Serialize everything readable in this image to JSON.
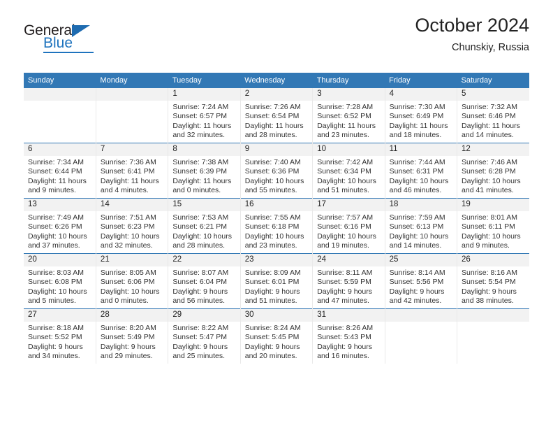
{
  "brand": {
    "name_part1": "General",
    "name_part2": "Blue"
  },
  "header": {
    "title": "October 2024",
    "location": "Chunskiy, Russia"
  },
  "weekday_headers": [
    "Sunday",
    "Monday",
    "Tuesday",
    "Wednesday",
    "Thursday",
    "Friday",
    "Saturday"
  ],
  "colors": {
    "header_blue": "#3278b5",
    "brand_blue": "#1e73be",
    "daynum_band": "#f2f2f2",
    "text": "#333333"
  },
  "weeks": [
    [
      {
        "day": "",
        "sunrise": "",
        "sunset": "",
        "daylight": "",
        "empty": true
      },
      {
        "day": "",
        "sunrise": "",
        "sunset": "",
        "daylight": "",
        "empty": true
      },
      {
        "day": "1",
        "sunrise": "Sunrise: 7:24 AM",
        "sunset": "Sunset: 6:57 PM",
        "daylight": "Daylight: 11 hours and 32 minutes."
      },
      {
        "day": "2",
        "sunrise": "Sunrise: 7:26 AM",
        "sunset": "Sunset: 6:54 PM",
        "daylight": "Daylight: 11 hours and 28 minutes."
      },
      {
        "day": "3",
        "sunrise": "Sunrise: 7:28 AM",
        "sunset": "Sunset: 6:52 PM",
        "daylight": "Daylight: 11 hours and 23 minutes."
      },
      {
        "day": "4",
        "sunrise": "Sunrise: 7:30 AM",
        "sunset": "Sunset: 6:49 PM",
        "daylight": "Daylight: 11 hours and 18 minutes."
      },
      {
        "day": "5",
        "sunrise": "Sunrise: 7:32 AM",
        "sunset": "Sunset: 6:46 PM",
        "daylight": "Daylight: 11 hours and 14 minutes."
      }
    ],
    [
      {
        "day": "6",
        "sunrise": "Sunrise: 7:34 AM",
        "sunset": "Sunset: 6:44 PM",
        "daylight": "Daylight: 11 hours and 9 minutes."
      },
      {
        "day": "7",
        "sunrise": "Sunrise: 7:36 AM",
        "sunset": "Sunset: 6:41 PM",
        "daylight": "Daylight: 11 hours and 4 minutes."
      },
      {
        "day": "8",
        "sunrise": "Sunrise: 7:38 AM",
        "sunset": "Sunset: 6:39 PM",
        "daylight": "Daylight: 11 hours and 0 minutes."
      },
      {
        "day": "9",
        "sunrise": "Sunrise: 7:40 AM",
        "sunset": "Sunset: 6:36 PM",
        "daylight": "Daylight: 10 hours and 55 minutes."
      },
      {
        "day": "10",
        "sunrise": "Sunrise: 7:42 AM",
        "sunset": "Sunset: 6:34 PM",
        "daylight": "Daylight: 10 hours and 51 minutes."
      },
      {
        "day": "11",
        "sunrise": "Sunrise: 7:44 AM",
        "sunset": "Sunset: 6:31 PM",
        "daylight": "Daylight: 10 hours and 46 minutes."
      },
      {
        "day": "12",
        "sunrise": "Sunrise: 7:46 AM",
        "sunset": "Sunset: 6:28 PM",
        "daylight": "Daylight: 10 hours and 41 minutes."
      }
    ],
    [
      {
        "day": "13",
        "sunrise": "Sunrise: 7:49 AM",
        "sunset": "Sunset: 6:26 PM",
        "daylight": "Daylight: 10 hours and 37 minutes."
      },
      {
        "day": "14",
        "sunrise": "Sunrise: 7:51 AM",
        "sunset": "Sunset: 6:23 PM",
        "daylight": "Daylight: 10 hours and 32 minutes."
      },
      {
        "day": "15",
        "sunrise": "Sunrise: 7:53 AM",
        "sunset": "Sunset: 6:21 PM",
        "daylight": "Daylight: 10 hours and 28 minutes."
      },
      {
        "day": "16",
        "sunrise": "Sunrise: 7:55 AM",
        "sunset": "Sunset: 6:18 PM",
        "daylight": "Daylight: 10 hours and 23 minutes."
      },
      {
        "day": "17",
        "sunrise": "Sunrise: 7:57 AM",
        "sunset": "Sunset: 6:16 PM",
        "daylight": "Daylight: 10 hours and 19 minutes."
      },
      {
        "day": "18",
        "sunrise": "Sunrise: 7:59 AM",
        "sunset": "Sunset: 6:13 PM",
        "daylight": "Daylight: 10 hours and 14 minutes."
      },
      {
        "day": "19",
        "sunrise": "Sunrise: 8:01 AM",
        "sunset": "Sunset: 6:11 PM",
        "daylight": "Daylight: 10 hours and 9 minutes."
      }
    ],
    [
      {
        "day": "20",
        "sunrise": "Sunrise: 8:03 AM",
        "sunset": "Sunset: 6:08 PM",
        "daylight": "Daylight: 10 hours and 5 minutes."
      },
      {
        "day": "21",
        "sunrise": "Sunrise: 8:05 AM",
        "sunset": "Sunset: 6:06 PM",
        "daylight": "Daylight: 10 hours and 0 minutes."
      },
      {
        "day": "22",
        "sunrise": "Sunrise: 8:07 AM",
        "sunset": "Sunset: 6:04 PM",
        "daylight": "Daylight: 9 hours and 56 minutes."
      },
      {
        "day": "23",
        "sunrise": "Sunrise: 8:09 AM",
        "sunset": "Sunset: 6:01 PM",
        "daylight": "Daylight: 9 hours and 51 minutes."
      },
      {
        "day": "24",
        "sunrise": "Sunrise: 8:11 AM",
        "sunset": "Sunset: 5:59 PM",
        "daylight": "Daylight: 9 hours and 47 minutes."
      },
      {
        "day": "25",
        "sunrise": "Sunrise: 8:14 AM",
        "sunset": "Sunset: 5:56 PM",
        "daylight": "Daylight: 9 hours and 42 minutes."
      },
      {
        "day": "26",
        "sunrise": "Sunrise: 8:16 AM",
        "sunset": "Sunset: 5:54 PM",
        "daylight": "Daylight: 9 hours and 38 minutes."
      }
    ],
    [
      {
        "day": "27",
        "sunrise": "Sunrise: 8:18 AM",
        "sunset": "Sunset: 5:52 PM",
        "daylight": "Daylight: 9 hours and 34 minutes."
      },
      {
        "day": "28",
        "sunrise": "Sunrise: 8:20 AM",
        "sunset": "Sunset: 5:49 PM",
        "daylight": "Daylight: 9 hours and 29 minutes."
      },
      {
        "day": "29",
        "sunrise": "Sunrise: 8:22 AM",
        "sunset": "Sunset: 5:47 PM",
        "daylight": "Daylight: 9 hours and 25 minutes."
      },
      {
        "day": "30",
        "sunrise": "Sunrise: 8:24 AM",
        "sunset": "Sunset: 5:45 PM",
        "daylight": "Daylight: 9 hours and 20 minutes."
      },
      {
        "day": "31",
        "sunrise": "Sunrise: 8:26 AM",
        "sunset": "Sunset: 5:43 PM",
        "daylight": "Daylight: 9 hours and 16 minutes."
      },
      {
        "day": "",
        "sunrise": "",
        "sunset": "",
        "daylight": "",
        "empty": true
      },
      {
        "day": "",
        "sunrise": "",
        "sunset": "",
        "daylight": "",
        "empty": true
      }
    ]
  ]
}
